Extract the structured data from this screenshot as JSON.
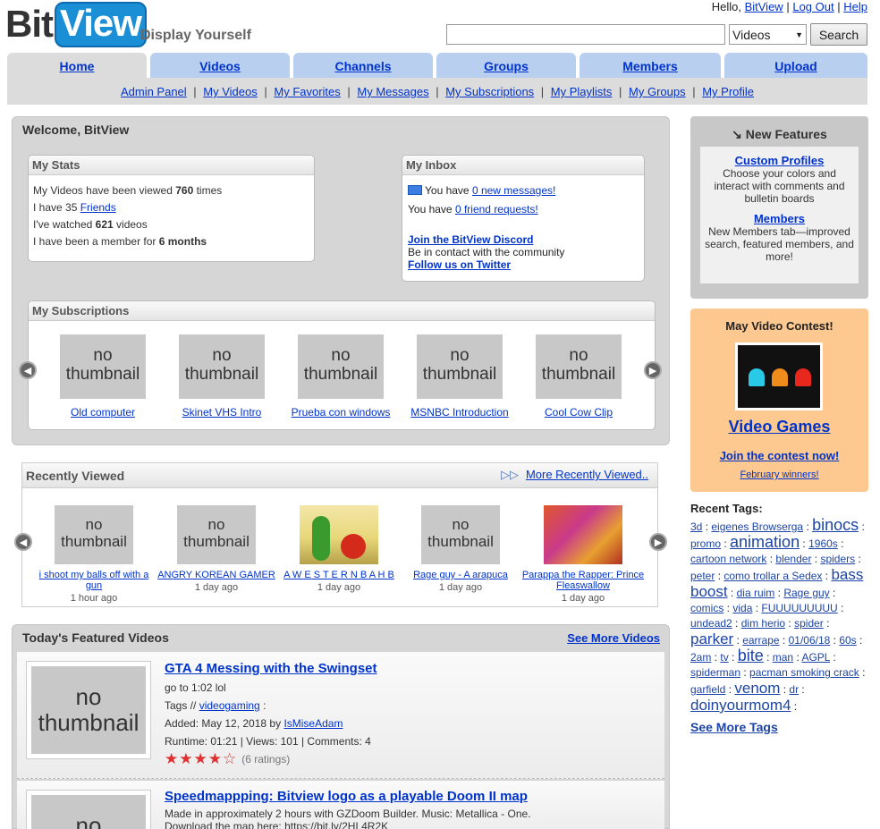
{
  "header": {
    "logo_left": "Bit",
    "logo_right": "View",
    "tagline": "Display Yourself",
    "greeting": "Hello,",
    "username": "BitView",
    "logout": "Log Out",
    "help": "Help",
    "sep": "|",
    "search_value": "",
    "search_type": "Videos",
    "search_button": "Search"
  },
  "tabs": [
    "Home",
    "Videos",
    "Channels",
    "Groups",
    "Members",
    "Upload"
  ],
  "subnav": [
    "Admin Panel",
    "My Videos",
    "My Favorites",
    "My Messages",
    "My Subscriptions",
    "My Playlists",
    "My Groups",
    "My Profile"
  ],
  "welcome": {
    "title": "Welcome, BitView",
    "stats_title": "My Stats",
    "views_pre": "My Videos have been viewed ",
    "views": "760",
    "views_post": " times",
    "friends_pre": "I have 35 ",
    "friends_link": "Friends",
    "watched_pre": "I've watched ",
    "watched": "621",
    "watched_post": " videos",
    "member_pre": "I have been a member for ",
    "member": "6 months",
    "inbox_title": "My Inbox",
    "msg_pre": "You have ",
    "msg_link": "0 new messages!",
    "req_pre": "You have ",
    "req_link": "0 friend requests!",
    "discord": "Join the BitView Discord",
    "community": "Be in contact with the community",
    "twitter": "Follow us on Twitter",
    "subs_title": "My Subscriptions",
    "no_thumb_1": "no",
    "no_thumb_2": "thumbnail",
    "subs": [
      "Old computer",
      "Skinet VHS Intro",
      "Prueba con windows",
      "MSNBC Introduction",
      "Cool Cow Clip"
    ]
  },
  "recent": {
    "title": "Recently Viewed",
    "more": "More Recently Viewed..",
    "items": [
      {
        "title": "i shoot my balls off with a gun",
        "ago": "1 hour ago"
      },
      {
        "title": "ANGRY KOREAN GAMER",
        "ago": "1 day ago"
      },
      {
        "title": "A W E S T E R N B A H B",
        "ago": "1 day ago"
      },
      {
        "title": "Rage guy - A arapuca",
        "ago": "1 day ago"
      },
      {
        "title": "Parappa the Rapper: Prince Fleaswallow",
        "ago": "1 day ago"
      }
    ]
  },
  "featured": {
    "title": "Today's Featured Videos",
    "more": "See More Videos",
    "videos": [
      {
        "title": "GTA 4 Messing with the Swingset",
        "desc": "go to 1:02 lol",
        "tags_pre": "Tags // ",
        "tag": "videogaming",
        "tag_post": " :",
        "added_pre": "Added: May 12, 2018 by ",
        "author": "IsMiseAdam",
        "runtime": "Runtime: 01:21 | Views: 101 | Comments: 4",
        "ratings": "(6 ratings)",
        "rating_value": 4.5
      },
      {
        "title": "Speedmappping: Bitview logo as a playable Doom II map",
        "desc": "Made in approximately 2 hours with GZDoom Builder. Music: Metallica - One.",
        "desc2": "Download the map here: https://bit.ly/2HL4R2K"
      }
    ]
  },
  "new_features": {
    "title": "New Features",
    "f1_title": "Custom Profiles",
    "f1_desc": "Choose your colors and interact with comments and bulletin boards",
    "f2_title": "Members",
    "f2_desc": "New Members tab—improved search, featured members, and more!"
  },
  "contest": {
    "title": "May Video Contest!",
    "theme": "Video Games",
    "join": "Join the contest now!",
    "winners": "February winners!"
  },
  "tags": {
    "title": "Recent Tags:",
    "more": "See More Tags",
    "list": [
      {
        "t": "3d",
        "s": 12
      },
      {
        "t": "eigenes Browserga",
        "s": 12
      },
      {
        "t": "binocs",
        "s": 17
      },
      {
        "t": "promo",
        "s": 12
      },
      {
        "t": "animation",
        "s": 17
      },
      {
        "t": "1960s",
        "s": 12
      },
      {
        "t": "cartoon network",
        "s": 12
      },
      {
        "t": "blender",
        "s": 12
      },
      {
        "t": "spiders",
        "s": 12
      },
      {
        "t": "peter",
        "s": 12
      },
      {
        "t": "como trollar a Sedex",
        "s": 12
      },
      {
        "t": "bass boost",
        "s": 16
      },
      {
        "t": "dia ruim",
        "s": 12
      },
      {
        "t": "Rage guy",
        "s": 12
      },
      {
        "t": "comics",
        "s": 12
      },
      {
        "t": "vida",
        "s": 12
      },
      {
        "t": "FUUUUUUUUU",
        "s": 12
      },
      {
        "t": "undead2",
        "s": 12
      },
      {
        "t": "dim herio",
        "s": 12
      },
      {
        "t": "spider",
        "s": 12
      },
      {
        "t": "parker",
        "s": 16
      },
      {
        "t": "earrape",
        "s": 12
      },
      {
        "t": "01/06/18",
        "s": 12
      },
      {
        "t": "60s",
        "s": 12
      },
      {
        "t": "2am",
        "s": 12
      },
      {
        "t": "tv",
        "s": 12
      },
      {
        "t": "bite",
        "s": 17
      },
      {
        "t": "man",
        "s": 12
      },
      {
        "t": "AGPL",
        "s": 12
      },
      {
        "t": "spiderman",
        "s": 12
      },
      {
        "t": "pacman smoking crack",
        "s": 12
      },
      {
        "t": "garfield",
        "s": 12
      },
      {
        "t": "venom",
        "s": 16
      },
      {
        "t": "dr",
        "s": 12
      },
      {
        "t": "doinyourmom4",
        "s": 16
      }
    ]
  },
  "colors": {
    "tab": "#b8cfef",
    "link": "#0033cc",
    "contest_bg": "#fdc990",
    "logo_blue": "#1a8fd6"
  }
}
